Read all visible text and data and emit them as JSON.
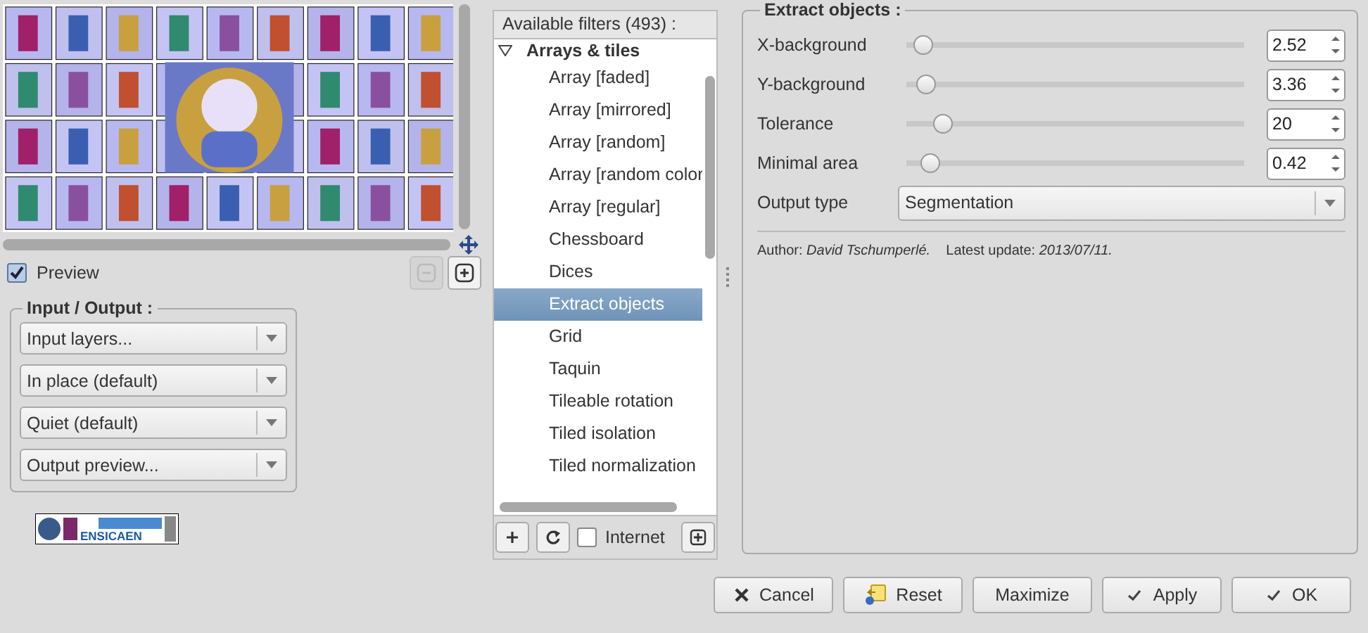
{
  "preview": {
    "checkbox": {
      "label": "Preview",
      "checked": true
    }
  },
  "zoom_buttons": [
    {
      "kind": "minus",
      "disabled": true
    },
    {
      "kind": "plus",
      "disabled": false
    }
  ],
  "input_output": {
    "title": "Input / Output :",
    "combos": [
      "Input layers...",
      "In place (default)",
      "Quiet (default)",
      "Output preview..."
    ]
  },
  "logo": {
    "text": "ENSICAEN"
  },
  "filters": {
    "header": "Available filters (493) :",
    "tree": [
      {
        "label": "Arrays & tiles",
        "expanded": true,
        "children": [
          {
            "label": "Array [faded]",
            "selected": false
          },
          {
            "label": "Array [mirrored]",
            "selected": false
          },
          {
            "label": "Array [random]",
            "selected": false
          },
          {
            "label": "Array [random color",
            "selected": false
          },
          {
            "label": "Array [regular]",
            "selected": false
          },
          {
            "label": "Chessboard",
            "selected": false
          },
          {
            "label": "Dices",
            "selected": false
          },
          {
            "label": "Extract objects",
            "selected": true
          },
          {
            "label": "Grid",
            "selected": false
          },
          {
            "label": "Taquin",
            "selected": false
          },
          {
            "label": "Tileable rotation",
            "selected": false
          },
          {
            "label": "Tiled isolation",
            "selected": false
          },
          {
            "label": "Tiled normalization",
            "selected": false
          }
        ]
      }
    ],
    "internet": {
      "label": "Internet",
      "checked": false
    }
  },
  "settings": {
    "title": "Extract objects :",
    "params": [
      {
        "kind": "slider",
        "label": "X-background",
        "level": 0.02,
        "value": "2.52"
      },
      {
        "kind": "slider",
        "label": "Y-background",
        "level": 0.03,
        "value": "3.36"
      },
      {
        "kind": "slider",
        "label": "Tolerance",
        "level": 0.08,
        "value": "20"
      },
      {
        "kind": "slider",
        "label": "Minimal area",
        "level": 0.04,
        "value": "0.42"
      },
      {
        "kind": "combo",
        "label": "Output type",
        "value": "Segmentation"
      }
    ],
    "credits": "Author: *David Tschumperlé.*    Latest update: *2013/07/11.*"
  },
  "buttons": [
    {
      "label": "Cancel",
      "kind": "cancel"
    },
    {
      "label": "Reset",
      "kind": "reset"
    },
    {
      "label": "Maximize",
      "kind": "plain"
    },
    {
      "label": "Apply",
      "kind": "confirm"
    },
    {
      "label": "OK",
      "kind": "confirm"
    }
  ]
}
